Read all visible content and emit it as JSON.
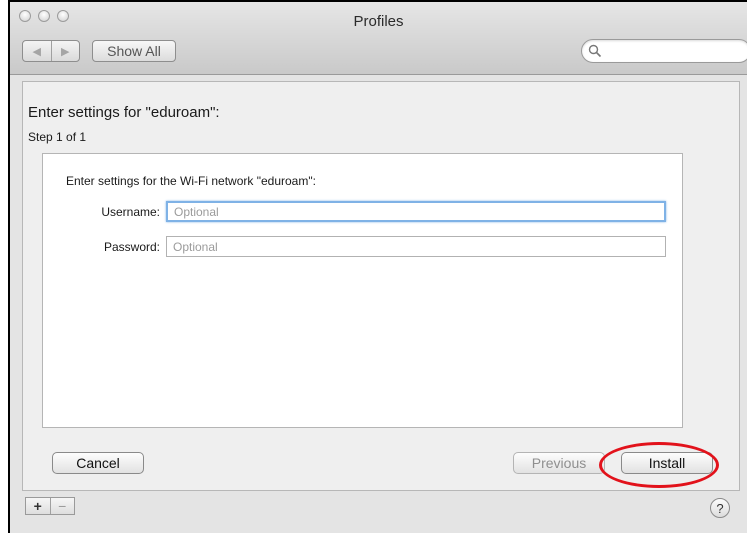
{
  "window": {
    "title": "Profiles"
  },
  "toolbar": {
    "back_icon": "back-arrow-icon",
    "forward_icon": "forward-arrow-icon",
    "show_all_label": "Show All",
    "search_placeholder": "",
    "search_icon": "magnifier-icon"
  },
  "dialog": {
    "heading": "Enter settings for \"eduroam\":",
    "step": "Step 1 of 1",
    "intro": "Enter settings for the Wi-Fi network \"eduroam\":",
    "username": {
      "label": "Username:",
      "placeholder": "Optional",
      "value": ""
    },
    "password": {
      "label": "Password:",
      "placeholder": "Optional",
      "value": ""
    }
  },
  "buttons": {
    "cancel": "Cancel",
    "previous": "Previous",
    "install": "Install"
  },
  "footer": {
    "add_label": "+",
    "remove_label": "−",
    "help_label": "?"
  },
  "colors": {
    "highlight_ring": "#e2121b",
    "focus_ring": "#7fb2e6"
  }
}
